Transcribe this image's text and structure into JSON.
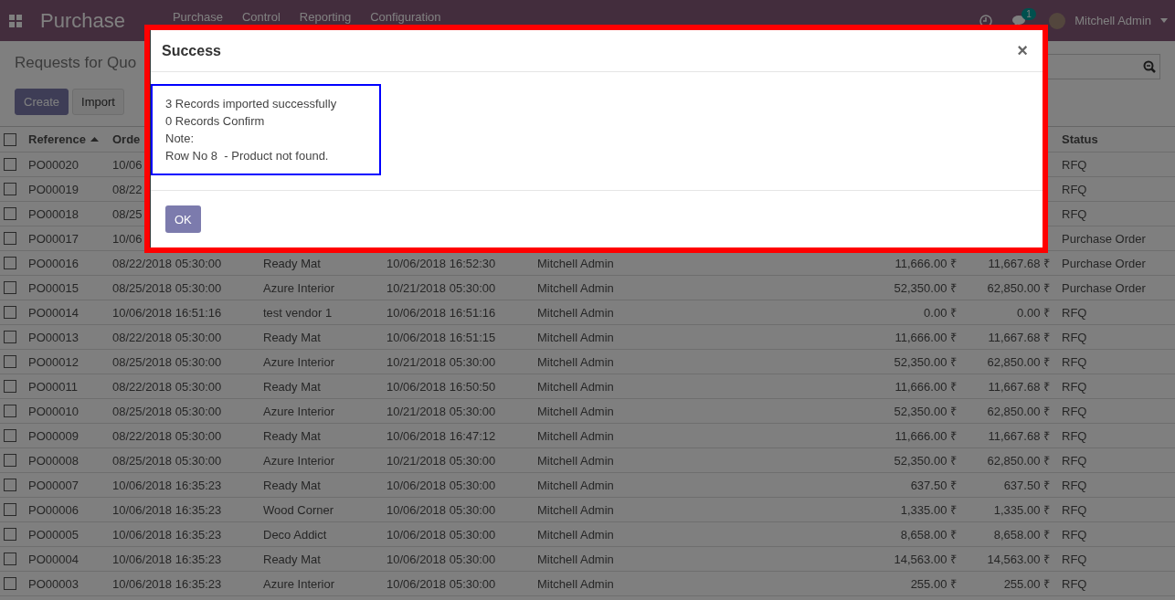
{
  "topbar": {
    "app": "Purchase",
    "menu": [
      "Purchase",
      "Control",
      "Reporting",
      "Configuration"
    ],
    "chat_count": "1",
    "user": "Mitchell Admin"
  },
  "control_panel": {
    "title": "Requests for Quo",
    "buttons": [
      "Create",
      "Import"
    ]
  },
  "table": {
    "header_checked": false,
    "columns": {
      "reference": {
        "label": "Reference",
        "sorted": true
      },
      "order_date": {
        "label": "Orde"
      },
      "status": {
        "label": "Status"
      }
    },
    "rows": [
      {
        "checked": false,
        "cells": {
          "reference": "PO00020",
          "order_date": "10/06",
          "status": "RFQ"
        }
      },
      {
        "checked": false,
        "cells": {
          "reference": "PO00019",
          "order_date": "08/22",
          "status": "RFQ"
        }
      },
      {
        "checked": false,
        "cells": {
          "reference": "PO00018",
          "order_date": "08/25",
          "status": "RFQ"
        }
      },
      {
        "checked": false,
        "cells": {
          "reference": "PO00017",
          "order_date": "10/06",
          "status": "Purchase Order"
        }
      },
      {
        "checked": false,
        "cells": {
          "reference": "PO00016",
          "order_date": "08/22/2018 05:30:00",
          "vendor": "Ready Mat",
          "scheduled_date": "10/06/2018 16:52:30",
          "representative": "Mitchell Admin",
          "untaxed": "11,666.00 ₹",
          "total": "11,667.68 ₹",
          "status": "Purchase Order"
        }
      },
      {
        "checked": false,
        "cells": {
          "reference": "PO00015",
          "order_date": "08/25/2018 05:30:00",
          "vendor": "Azure Interior",
          "scheduled_date": "10/21/2018 05:30:00",
          "representative": "Mitchell Admin",
          "untaxed": "52,350.00 ₹",
          "total": "62,850.00 ₹",
          "status": "Purchase Order"
        }
      },
      {
        "checked": false,
        "cells": {
          "reference": "PO00014",
          "order_date": "10/06/2018 16:51:16",
          "vendor": "test vendor 1",
          "scheduled_date": "10/06/2018 16:51:16",
          "representative": "Mitchell Admin",
          "untaxed": "0.00 ₹",
          "total": "0.00 ₹",
          "status": "RFQ"
        }
      },
      {
        "checked": false,
        "cells": {
          "reference": "PO00013",
          "order_date": "08/22/2018 05:30:00",
          "vendor": "Ready Mat",
          "scheduled_date": "10/06/2018 16:51:15",
          "representative": "Mitchell Admin",
          "untaxed": "11,666.00 ₹",
          "total": "11,667.68 ₹",
          "status": "RFQ"
        }
      },
      {
        "checked": false,
        "cells": {
          "reference": "PO00012",
          "order_date": "08/25/2018 05:30:00",
          "vendor": "Azure Interior",
          "scheduled_date": "10/21/2018 05:30:00",
          "representative": "Mitchell Admin",
          "untaxed": "52,350.00 ₹",
          "total": "62,850.00 ₹",
          "status": "RFQ"
        }
      },
      {
        "checked": false,
        "cells": {
          "reference": "PO00011",
          "order_date": "08/22/2018 05:30:00",
          "vendor": "Ready Mat",
          "scheduled_date": "10/06/2018 16:50:50",
          "representative": "Mitchell Admin",
          "untaxed": "11,666.00 ₹",
          "total": "11,667.68 ₹",
          "status": "RFQ"
        }
      },
      {
        "checked": false,
        "cells": {
          "reference": "PO00010",
          "order_date": "08/25/2018 05:30:00",
          "vendor": "Azure Interior",
          "scheduled_date": "10/21/2018 05:30:00",
          "representative": "Mitchell Admin",
          "untaxed": "52,350.00 ₹",
          "total": "62,850.00 ₹",
          "status": "RFQ"
        }
      },
      {
        "checked": false,
        "cells": {
          "reference": "PO00009",
          "order_date": "08/22/2018 05:30:00",
          "vendor": "Ready Mat",
          "scheduled_date": "10/06/2018 16:47:12",
          "representative": "Mitchell Admin",
          "untaxed": "11,666.00 ₹",
          "total": "11,667.68 ₹",
          "status": "RFQ"
        }
      },
      {
        "checked": false,
        "cells": {
          "reference": "PO00008",
          "order_date": "08/25/2018 05:30:00",
          "vendor": "Azure Interior",
          "scheduled_date": "10/21/2018 05:30:00",
          "representative": "Mitchell Admin",
          "untaxed": "52,350.00 ₹",
          "total": "62,850.00 ₹",
          "status": "RFQ"
        }
      },
      {
        "checked": false,
        "cells": {
          "reference": "PO00007",
          "order_date": "10/06/2018 16:35:23",
          "vendor": "Ready Mat",
          "scheduled_date": "10/06/2018 05:30:00",
          "representative": "Mitchell Admin",
          "untaxed": "637.50 ₹",
          "total": "637.50 ₹",
          "status": "RFQ"
        }
      },
      {
        "checked": false,
        "cells": {
          "reference": "PO00006",
          "order_date": "10/06/2018 16:35:23",
          "vendor": "Wood Corner",
          "scheduled_date": "10/06/2018 05:30:00",
          "representative": "Mitchell Admin",
          "untaxed": "1,335.00 ₹",
          "total": "1,335.00 ₹",
          "status": "RFQ"
        }
      },
      {
        "checked": false,
        "cells": {
          "reference": "PO00005",
          "order_date": "10/06/2018 16:35:23",
          "vendor": "Deco Addict",
          "scheduled_date": "10/06/2018 05:30:00",
          "representative": "Mitchell Admin",
          "untaxed": "8,658.00 ₹",
          "total": "8,658.00 ₹",
          "status": "RFQ"
        }
      },
      {
        "checked": false,
        "cells": {
          "reference": "PO00004",
          "order_date": "10/06/2018 16:35:23",
          "vendor": "Ready Mat",
          "scheduled_date": "10/06/2018 05:30:00",
          "representative": "Mitchell Admin",
          "untaxed": "14,563.00 ₹",
          "total": "14,563.00 ₹",
          "status": "RFQ"
        }
      },
      {
        "checked": false,
        "cells": {
          "reference": "PO00003",
          "order_date": "10/06/2018 16:35:23",
          "vendor": "Azure Interior",
          "scheduled_date": "10/06/2018 05:30:00",
          "representative": "Mitchell Admin",
          "untaxed": "255.00 ₹",
          "total": "255.00 ₹",
          "status": "RFQ"
        }
      }
    ]
  },
  "dialog": {
    "title": "Success",
    "close": "×",
    "messages": [
      "3 Records imported successfully",
      "0 Records Confirm",
      "Note:",
      "Row No 8  - Product not found."
    ],
    "button": "OK"
  }
}
